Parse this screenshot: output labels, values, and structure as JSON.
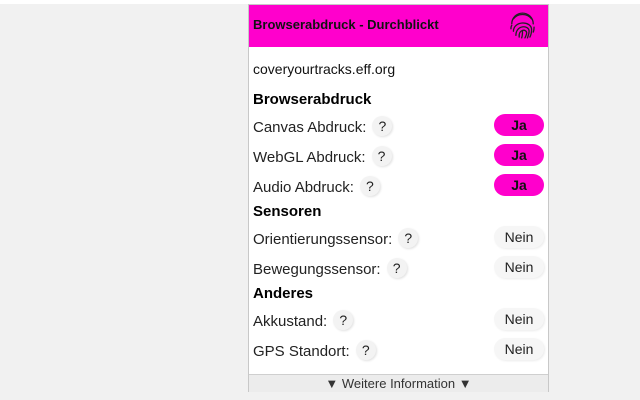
{
  "header": {
    "title": "Browserabdruck - Durchblickt",
    "icon": "fingerprint-icon",
    "color": "#ff00cc"
  },
  "site": "coveryourtracks.eff.org",
  "sections": [
    {
      "title": "Browserabdruck",
      "rows": [
        {
          "label": "Canvas Abdruck:",
          "help": "?",
          "value": "Ja",
          "status": "yes"
        },
        {
          "label": "WebGL Abdruck:",
          "help": "?",
          "value": "Ja",
          "status": "yes"
        },
        {
          "label": "Audio Abdruck:",
          "help": "?",
          "value": "Ja",
          "status": "yes"
        }
      ]
    },
    {
      "title": "Sensoren",
      "rows": [
        {
          "label": "Orientierungssensor:",
          "help": "?",
          "value": "Nein",
          "status": "no"
        },
        {
          "label": "Bewegungssensor:",
          "help": "?",
          "value": "Nein",
          "status": "no"
        }
      ]
    },
    {
      "title": "Anderes",
      "rows": [
        {
          "label": "Akkustand:",
          "help": "?",
          "value": "Nein",
          "status": "no"
        },
        {
          "label": "GPS Standort:",
          "help": "?",
          "value": "Nein",
          "status": "no"
        }
      ]
    }
  ],
  "footer": {
    "label": "▼ Weitere Information ▼"
  }
}
